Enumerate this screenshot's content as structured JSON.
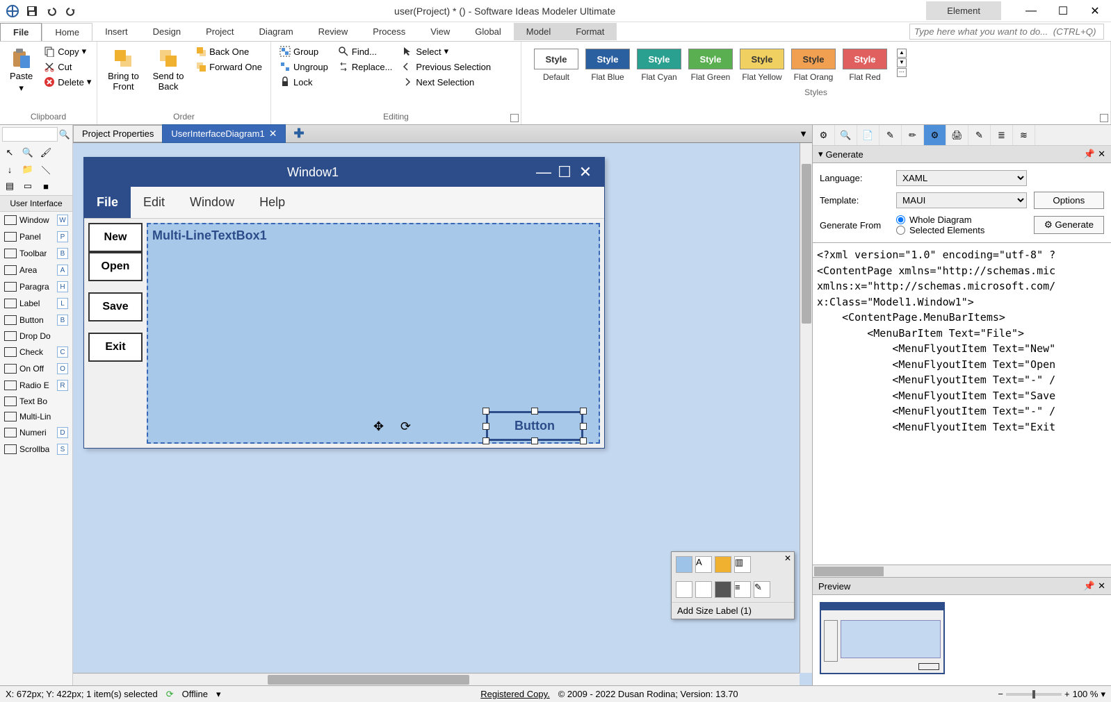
{
  "titlebar": {
    "title": "user(Project) * () - Software Ideas Modeler Ultimate",
    "context_tab": "Element"
  },
  "menu": {
    "file": "File",
    "home": "Home",
    "insert": "Insert",
    "design": "Design",
    "project": "Project",
    "diagram": "Diagram",
    "review": "Review",
    "process": "Process",
    "view": "View",
    "global": "Global",
    "model": "Model",
    "format": "Format",
    "search_placeholder": "Type here what you want to do...  (CTRL+Q)"
  },
  "ribbon": {
    "clipboard": {
      "label": "Clipboard",
      "paste": "Paste",
      "copy": "Copy",
      "cut": "Cut",
      "delete": "Delete"
    },
    "order": {
      "label": "Order",
      "bring_front": "Bring to Front",
      "send_back": "Send to Back",
      "back_one": "Back One",
      "forward_one": "Forward One"
    },
    "editing": {
      "label": "Editing",
      "group": "Group",
      "ungroup": "Ungroup",
      "lock": "Lock",
      "find": "Find...",
      "replace": "Replace...",
      "select": "Select",
      "prev_sel": "Previous Selection",
      "next_sel": "Next Selection"
    },
    "styles": {
      "label": "Styles",
      "style_text": "Style",
      "names": [
        "Default",
        "Flat Blue",
        "Flat Cyan",
        "Flat Green",
        "Flat Yellow",
        "Flat Orang",
        "Flat Red"
      ]
    }
  },
  "left_tools": {
    "section": "User Interface",
    "items": [
      {
        "label": "Window",
        "key": "W"
      },
      {
        "label": "Panel",
        "key": "P"
      },
      {
        "label": "Toolbar",
        "key": "B"
      },
      {
        "label": "Area",
        "key": "A"
      },
      {
        "label": "Paragra",
        "key": "H"
      },
      {
        "label": "Label",
        "key": "L"
      },
      {
        "label": "Button",
        "key": "B"
      },
      {
        "label": "Drop Do",
        "key": ""
      },
      {
        "label": "Check",
        "key": "C"
      },
      {
        "label": "On Off",
        "key": "O"
      },
      {
        "label": "Radio E",
        "key": "R"
      },
      {
        "label": "Text Bo",
        "key": ""
      },
      {
        "label": "Multi-Lin",
        "key": ""
      },
      {
        "label": "Numeri",
        "key": "D"
      },
      {
        "label": "Scrollba",
        "key": "S"
      }
    ]
  },
  "diagram_tabs": {
    "tab1": "Project Properties",
    "tab2": "UserInterfaceDiagram1"
  },
  "mock": {
    "window_title": "Window1",
    "menu": [
      "File",
      "Edit",
      "Window",
      "Help"
    ],
    "side_btns": [
      "New",
      "Open",
      "Save",
      "Exit"
    ],
    "textbox_label": "Multi-LineTextBox1",
    "button_label": "Button",
    "popup_label": "Add Size Label (1)"
  },
  "generate": {
    "panel_title": "Generate",
    "language_lbl": "Language:",
    "language_val": "XAML",
    "template_lbl": "Template:",
    "template_val": "MAUI",
    "options_btn": "Options",
    "from_lbl": "Generate From",
    "radio1": "Whole Diagram",
    "radio2": "Selected Elements",
    "generate_btn": "Generate",
    "code": "<?xml version=\"1.0\" encoding=\"utf-8\" ?\n<ContentPage xmlns=\"http://schemas.mic\nxmlns:x=\"http://schemas.microsoft.com/\nx:Class=\"Model1.Window1\">\n    <ContentPage.MenuBarItems>\n        <MenuBarItem Text=\"File\">\n            <MenuFlyoutItem Text=\"New\"\n            <MenuFlyoutItem Text=\"Open\n            <MenuFlyoutItem Text=\"-\" /\n            <MenuFlyoutItem Text=\"Save\n            <MenuFlyoutItem Text=\"-\" /\n            <MenuFlyoutItem Text=\"Exit"
  },
  "preview": {
    "title": "Preview"
  },
  "status": {
    "coords": "X: 672px; Y: 422px; 1 item(s) selected",
    "offline": "Offline",
    "registered": "Registered Copy.",
    "copyright": "© 2009 - 2022 Dusan Rodina; Version: 13.70",
    "zoom": "100 %"
  }
}
